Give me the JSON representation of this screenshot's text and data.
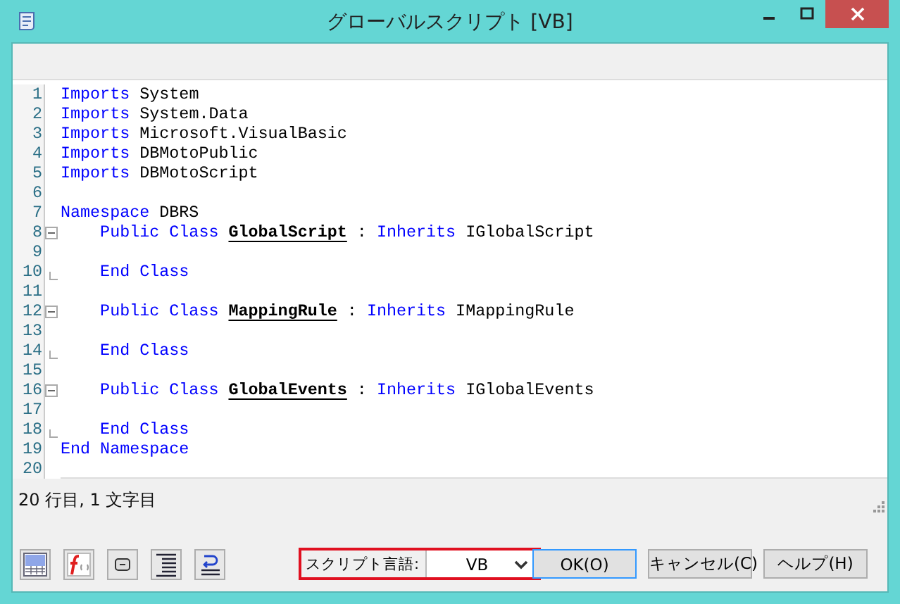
{
  "window": {
    "title": "グローバルスクリプト [VB]"
  },
  "editor": {
    "lines": [
      {
        "number": "1",
        "tokens": [
          {
            "kind": "keyword",
            "text": "Imports"
          },
          {
            "kind": "plain",
            "text": " System"
          }
        ]
      },
      {
        "number": "2",
        "tokens": [
          {
            "kind": "keyword",
            "text": "Imports"
          },
          {
            "kind": "plain",
            "text": " System.Data"
          }
        ]
      },
      {
        "number": "3",
        "tokens": [
          {
            "kind": "keyword",
            "text": "Imports"
          },
          {
            "kind": "plain",
            "text": " Microsoft.VisualBasic"
          }
        ]
      },
      {
        "number": "4",
        "tokens": [
          {
            "kind": "keyword",
            "text": "Imports"
          },
          {
            "kind": "plain",
            "text": " DBMotoPublic"
          }
        ]
      },
      {
        "number": "5",
        "tokens": [
          {
            "kind": "keyword",
            "text": "Imports"
          },
          {
            "kind": "plain",
            "text": " DBMotoScript"
          }
        ]
      },
      {
        "number": "6"
      },
      {
        "number": "7",
        "tokens": [
          {
            "kind": "keyword",
            "text": "Namespace"
          },
          {
            "kind": "plain",
            "text": " DBRS"
          }
        ]
      },
      {
        "number": "8",
        "kind": "fold_start",
        "expanded": true,
        "tokens": [
          {
            "kind": "keyword",
            "text": "    Public Class "
          },
          {
            "kind": "classname",
            "text": "GlobalScript"
          },
          {
            "kind": "plain",
            "text": " : "
          },
          {
            "kind": "keyword",
            "text": "Inherits"
          },
          {
            "kind": "plain",
            "text": " IGlobalScript"
          }
        ]
      },
      {
        "number": "9"
      },
      {
        "number": "10",
        "kind": "fold_end",
        "tokens": [
          {
            "kind": "keyword",
            "text": "    End Class"
          }
        ]
      },
      {
        "number": "11"
      },
      {
        "number": "12",
        "kind": "fold_start",
        "expanded": true,
        "tokens": [
          {
            "kind": "keyword",
            "text": "    Public Class "
          },
          {
            "kind": "classname",
            "text": "MappingRule"
          },
          {
            "kind": "plain",
            "text": " : "
          },
          {
            "kind": "keyword",
            "text": "Inherits"
          },
          {
            "kind": "plain",
            "text": " IMappingRule"
          }
        ]
      },
      {
        "number": "13"
      },
      {
        "number": "14",
        "kind": "fold_end",
        "tokens": [
          {
            "kind": "keyword",
            "text": "    End Class"
          }
        ]
      },
      {
        "number": "15"
      },
      {
        "number": "16",
        "kind": "fold_start",
        "expanded": true,
        "tokens": [
          {
            "kind": "keyword",
            "text": "    Public Class "
          },
          {
            "kind": "classname",
            "text": "GlobalEvents"
          },
          {
            "kind": "plain",
            "text": " : "
          },
          {
            "kind": "keyword",
            "text": "Inherits"
          },
          {
            "kind": "plain",
            "text": " IGlobalEvents"
          }
        ]
      },
      {
        "number": "17"
      },
      {
        "number": "18",
        "kind": "fold_end",
        "tokens": [
          {
            "kind": "keyword",
            "text": "    End Class"
          }
        ]
      },
      {
        "number": "19",
        "tokens": [
          {
            "kind": "keyword",
            "text": "End Namespace"
          }
        ]
      },
      {
        "number": "20"
      }
    ]
  },
  "status_bar": {
    "text": "20 行目, 1 文字目"
  },
  "toolbar": {
    "tools": [
      {
        "kind": "grid"
      },
      {
        "kind": "function"
      },
      {
        "kind": "field"
      },
      {
        "kind": "align"
      },
      {
        "kind": "undo"
      }
    ]
  },
  "language": {
    "label": "スクリプト言語:",
    "value": "VB"
  },
  "buttons": [
    {
      "label": "OK(O)",
      "default": true
    },
    {
      "label": "キャンセル(C)",
      "default": false
    },
    {
      "label": "ヘルプ(H)",
      "default": false
    }
  ]
}
